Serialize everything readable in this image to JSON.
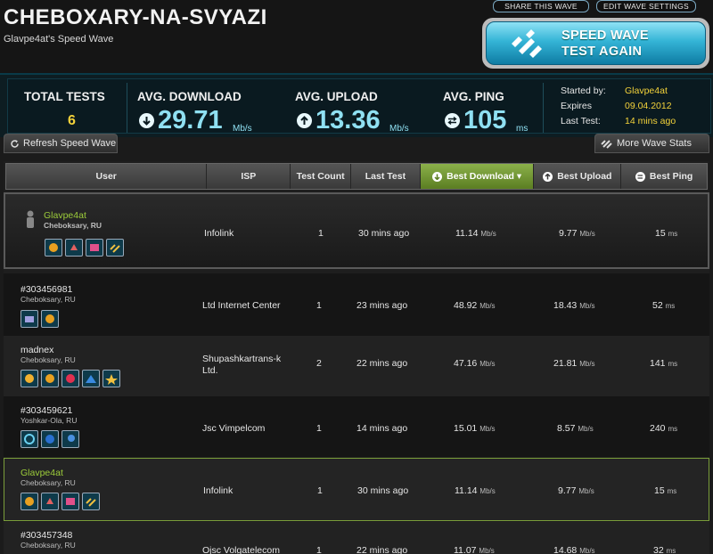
{
  "header": {
    "title": "CHEBOXARY-NA-SVYAZI",
    "subtitle": "Glavpe4at's Speed Wave",
    "share_btn": "SHARE THIS WAVE",
    "edit_btn": "EDIT WAVE SETTINGS",
    "speed_btn_line1": "SPEED WAVE",
    "speed_btn_line2": "TEST AGAIN"
  },
  "stats": {
    "total_label": "TOTAL TESTS",
    "total_value": "6",
    "download_label": "AVG. DOWNLOAD",
    "download_value": "29.71",
    "download_unit": "Mb/s",
    "upload_label": "AVG. UPLOAD",
    "upload_value": "13.36",
    "upload_unit": "Mb/s",
    "ping_label": "AVG. PING",
    "ping_value": "105",
    "ping_unit": "ms",
    "started_label": "Started by:",
    "started_value": "Glavpe4at",
    "expires_label": "Expires",
    "expires_value": "09.04.2012",
    "last_label": "Last Test:",
    "last_value": "14 mins ago"
  },
  "tabs": {
    "refresh": "Refresh Speed Wave",
    "more": "More Wave Stats"
  },
  "columns": {
    "user": "User",
    "isp": "ISP",
    "count": "Test Count",
    "last": "Last Test",
    "download": "Best Download ▾",
    "upload": "Best Upload",
    "ping": "Best Ping"
  },
  "rows": [
    {
      "name": "Glavpe4at",
      "loc": "Cheboksary, RU",
      "isp": "Infolink",
      "isp2": "",
      "count": "1",
      "last": "30 mins ago",
      "down": "11.14",
      "up": "9.77",
      "ping": "15",
      "down_unit": "Mb/s",
      "up_unit": "Mb/s",
      "ping_unit": "ms"
    },
    {
      "name": "#303456981",
      "loc": "Cheboksary, RU",
      "isp": "Ltd Internet Center",
      "isp2": "",
      "count": "1",
      "last": "23 mins ago",
      "down": "48.92",
      "up": "18.43",
      "ping": "52",
      "down_unit": "Mb/s",
      "up_unit": "Mb/s",
      "ping_unit": "ms"
    },
    {
      "name": "madnex",
      "loc": "Cheboksary, RU",
      "isp": "Shupashkartrans-k",
      "isp2": "Ltd.",
      "count": "2",
      "last": "22 mins ago",
      "down": "47.16",
      "up": "21.81",
      "ping": "141",
      "down_unit": "Mb/s",
      "up_unit": "Mb/s",
      "ping_unit": "ms"
    },
    {
      "name": "#303459621",
      "loc": "Yoshkar-Ola, RU",
      "isp": "Jsc Vimpelcom",
      "isp2": "",
      "count": "1",
      "last": "14 mins ago",
      "down": "15.01",
      "up": "8.57",
      "ping": "240",
      "down_unit": "Mb/s",
      "up_unit": "Mb/s",
      "ping_unit": "ms"
    },
    {
      "name": "Glavpe4at",
      "loc": "Cheboksary, RU",
      "isp": "Infolink",
      "isp2": "",
      "count": "1",
      "last": "30 mins ago",
      "down": "11.14",
      "up": "9.77",
      "ping": "15",
      "down_unit": "Mb/s",
      "up_unit": "Mb/s",
      "ping_unit": "ms"
    },
    {
      "name": "#303457348",
      "loc": "Cheboksary, RU",
      "isp": "Ojsc Volgatelecom",
      "isp2": "",
      "count": "1",
      "last": "22 mins ago",
      "down": "11.07",
      "up": "14.68",
      "ping": "32",
      "down_unit": "Mb/s",
      "up_unit": "Mb/s",
      "ping_unit": "ms"
    }
  ]
}
